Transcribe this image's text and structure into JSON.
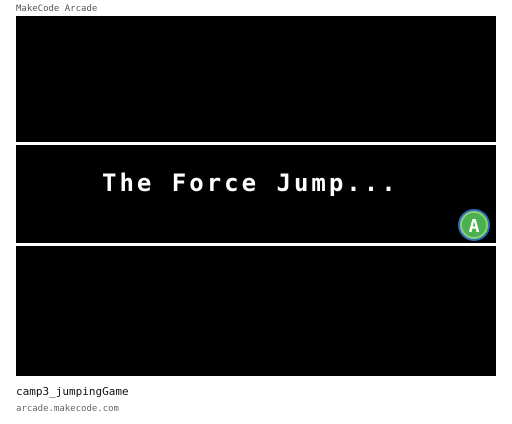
{
  "header": {
    "title": "MakeCode Arcade"
  },
  "game": {
    "dialog_text": "The Force Jump...",
    "button_label": "A",
    "colors": {
      "background": "#000000",
      "stripe": "#ffffff",
      "text": "#ffffff",
      "button_outer": "#2f6fb0",
      "button_inner": "#4caf50"
    },
    "icons": [
      "a-button-icon"
    ]
  },
  "footer": {
    "project_name": "camp3_jumpingGame",
    "site_url": "arcade.makecode.com"
  }
}
